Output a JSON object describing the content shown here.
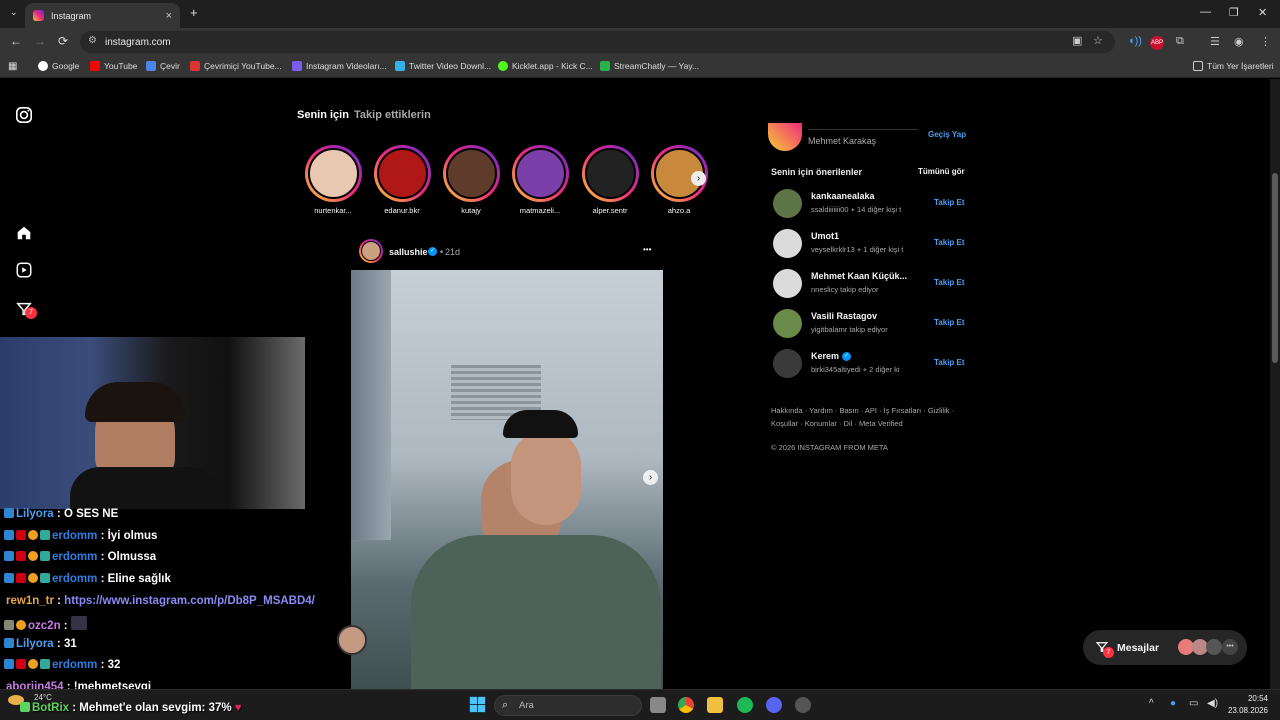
{
  "browser": {
    "tab_title": "Instagram",
    "new_tab": "+",
    "url": "instagram.com",
    "bookmarks": [
      "Google",
      "YouTube",
      "Çevir",
      "Çevrimiçi YouTube...",
      "Instagram Videoları...",
      "Twitter Video Downl...",
      "Kicklet.app - Kick C...",
      "StreamChatly — Yay..."
    ],
    "all_bookmarks": "Tüm Yer İşaretleri",
    "extension_abp": "ABP"
  },
  "sidebar": {
    "notification_count": "7"
  },
  "feed": {
    "tabs": [
      "Senin için",
      "Takip ettiklerin"
    ],
    "stories": [
      "nurtenkar...",
      "edanur.bkr",
      "kutajy",
      "matmazeli...",
      "alper.sentr",
      "ahzo.a"
    ],
    "post": {
      "username": "sallushie",
      "time": "21d",
      "more": "•••"
    }
  },
  "right": {
    "current_user": "Mehmet Karakaş",
    "switch": "Geçiş Yap",
    "suggestions_title": "Senin için önerilenler",
    "see_all": "Tümünü gör",
    "suggestions": [
      {
        "name": "kankaanealaka",
        "sub": "ssaldiiiiiii00 + 14 diğer kişi t",
        "follow": "Takip Et"
      },
      {
        "name": "Umot1",
        "sub": "veyselkrklr13 + 1 diğer kişi t",
        "follow": "Takip Et"
      },
      {
        "name": "Mehmet Kaan Küçük...",
        "sub": "nneslicy takip ediyor",
        "follow": "Takip Et"
      },
      {
        "name": "Vasili Rastagov",
        "sub": "yigitbalamr takip ediyor",
        "follow": "Takip Et"
      },
      {
        "name": "Kerem",
        "sub": "birki345altiyedi + 2 diğer ki",
        "follow": "Takip Et"
      }
    ],
    "footer_line1": "Hakkında · Yardım · Basın · API · İş Fırsatları · Gizlilik ·",
    "footer_line2": "Koşullar · Konumlar · Dil · Meta Verified",
    "copyright": "© 2026 INSTAGRAM FROM META"
  },
  "messages": {
    "label": "Mesajlar",
    "count": "7"
  },
  "chat": [
    {
      "user": "Lilyora",
      "msg": "O SES NE",
      "color": "#4a9ff5"
    },
    {
      "user": "erdomm",
      "msg": "İyi olmus",
      "color": "#2f7de1"
    },
    {
      "user": "erdomm",
      "msg": "Olmussa",
      "color": "#2f7de1"
    },
    {
      "user": "erdomm",
      "msg": "Eline sağlık",
      "color": "#2f7de1"
    },
    {
      "user": "rew1n_tr",
      "msg": "https://www.instagram.com/p/Db8P_MSABD4/",
      "color": "#e2a646"
    },
    {
      "user": "ozc2n",
      "msg": "",
      "color": "#c77de0"
    },
    {
      "user": "Lilyora",
      "msg": "31",
      "color": "#4a9ff5"
    },
    {
      "user": "erdomm",
      "msg": "32",
      "color": "#2f7de1"
    },
    {
      "user": "aborjin454",
      "msg": "!mehmetsevgi",
      "color": "#c77de0"
    },
    {
      "user": "BotRix",
      "msg": "Mehmet'e olan sevgim: 37%",
      "color": "#5fd35f"
    }
  ],
  "taskbar": {
    "search": "Ara",
    "weather": "24°C",
    "time": "20:54",
    "date": "23.08.2026"
  }
}
